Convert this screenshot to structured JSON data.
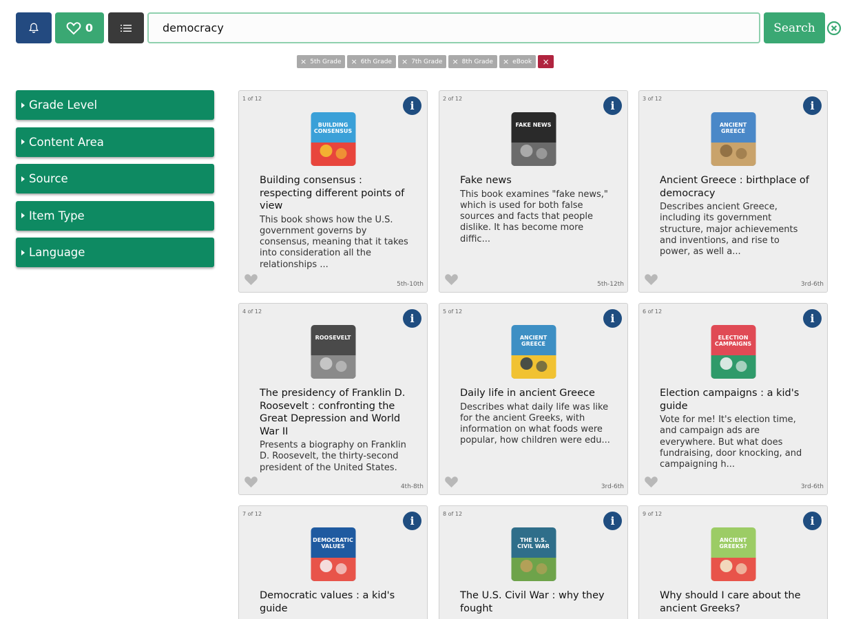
{
  "toolbar": {
    "favorites_count": "0",
    "search_value": "democracy",
    "search_placeholder": "",
    "search_label": "Search"
  },
  "filters": {
    "chips": [
      "5th Grade",
      "6th Grade",
      "7th Grade",
      "8th Grade",
      "eBook"
    ]
  },
  "sidebar": {
    "items": [
      {
        "label": "Grade Level"
      },
      {
        "label": "Content Area"
      },
      {
        "label": "Source"
      },
      {
        "label": "Item Type"
      },
      {
        "label": "Language"
      }
    ]
  },
  "results": {
    "items": [
      {
        "index": "1 of 12",
        "title": "Building consensus : respecting different points of view",
        "desc": "This book shows how the U.S. government governs by consensus, meaning that it takes into consideration all the relationships ...",
        "grade": "5th-10th",
        "cover_colors": [
          "#3aa0d8",
          "#e8453c",
          "#f4c430"
        ],
        "cover_text": "BUILDING CONSENSUS"
      },
      {
        "index": "2 of 12",
        "title": "Fake news",
        "desc": "This book examines \"fake news,\" which is used for both false sources and facts that people dislike. It has become more diffic...",
        "grade": "5th-12th",
        "cover_colors": [
          "#2a2a2a",
          "#6b6b6b",
          "#b5b5b5"
        ],
        "cover_text": "FAKE NEWS"
      },
      {
        "index": "3 of 12",
        "title": "Ancient Greece : birthplace of democracy",
        "desc": "Describes ancient Greece, including its government structure, major achievements and inventions, and rise to power, as well a...",
        "grade": "3rd-6th",
        "cover_colors": [
          "#4a88c8",
          "#c9a36b",
          "#8a6a3e"
        ],
        "cover_text": "ANCIENT GREECE"
      },
      {
        "index": "4 of 12",
        "title": "The presidency of Franklin D. Roosevelt : confronting the Great Depression and World War II",
        "desc": "Presents a biography on Franklin D. Roosevelt, the thirty-second president of the United States.",
        "grade": "4th-8th",
        "cover_colors": [
          "#4a4a4a",
          "#8a8a8a",
          "#cfcfcf"
        ],
        "cover_text": "ROOSEVELT"
      },
      {
        "index": "5 of 12",
        "title": "Daily life in ancient Greece",
        "desc": "Describes what daily life was like for the ancient Greeks, with information on what foods were popular, how children were edu...",
        "grade": "3rd-6th",
        "cover_colors": [
          "#3d8fc4",
          "#f1c232",
          "#2b3a4a"
        ],
        "cover_text": "ANCIENT GREECE"
      },
      {
        "index": "6 of 12",
        "title": "Election campaigns : a kid's guide",
        "desc": "Vote for me! It's election time, and campaign ads are everywhere. But what does fundraising, door knocking, and campaigning h...",
        "grade": "3rd-6th",
        "cover_colors": [
          "#e04a55",
          "#2f9a6a",
          "#f6f6f6"
        ],
        "cover_text": "ELECTION CAMPAIGNS"
      },
      {
        "index": "7 of 12",
        "title": "Democratic values : a kid's guide",
        "desc": "",
        "grade": "",
        "cover_colors": [
          "#1f5aa0",
          "#e8544a",
          "#f6f6f6"
        ],
        "cover_text": "DEMOCRATIC VALUES"
      },
      {
        "index": "8 of 12",
        "title": "The U.S. Civil War : why they fought",
        "desc": "",
        "grade": "",
        "cover_colors": [
          "#2f6e8a",
          "#6ea34a",
          "#c0a05a"
        ],
        "cover_text": "THE U.S. CIVIL WAR"
      },
      {
        "index": "9 of 12",
        "title": "Why should I care about the ancient Greeks?",
        "desc": "",
        "grade": "",
        "cover_colors": [
          "#9ccc65",
          "#e8544a",
          "#f3f0d0"
        ],
        "cover_text": "ANCIENT GREEKS?"
      }
    ]
  },
  "colors": {
    "primary_green": "#3aa873",
    "facet_green": "#0e8a62",
    "navy": "#234a80",
    "info_blue": "#1f4d80",
    "chip_gray": "#a9a9a9",
    "chip_clear_red": "#b0243f"
  },
  "icons": {
    "bell": "bell-icon",
    "heart": "heart-icon",
    "list": "list-icon",
    "clear": "circle-x-icon",
    "info": "info-icon",
    "caret": "caret-right-icon"
  }
}
